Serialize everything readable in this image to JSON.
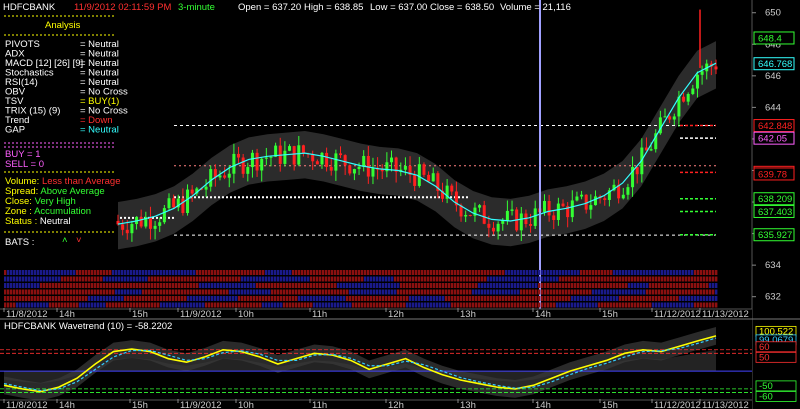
{
  "header": {
    "symbol": "HDFCBANK",
    "datetime": "11/9/2012 02:11:59 PM",
    "interval": "3-minute",
    "open": "Open = 637.20",
    "high": "High = 638.85",
    "low": "Low = 637.00",
    "close": "Close = 638.50",
    "volume": "Volume = 21,116"
  },
  "analysis": {
    "title": "Analysis",
    "rows": [
      {
        "label": "PIVOTS",
        "value": "= Neutral",
        "color": "#ffffff"
      },
      {
        "label": "ADX",
        "value": "= Neutral",
        "color": "#ffffff"
      },
      {
        "label": "MACD [12] [26] [9]",
        "value": "= Neutral",
        "color": "#ffffff"
      },
      {
        "label": "Stochastics",
        "value": "= Neutral",
        "color": "#ffffff"
      },
      {
        "label": "RSI(14)",
        "value": "= Neutral",
        "color": "#ffffff"
      },
      {
        "label": "OBV",
        "value": "= No Cross",
        "color": "#ffffff"
      },
      {
        "label": "TSV",
        "value": "= BUY(1)",
        "color": "#ffff00"
      },
      {
        "label": "TRIX (15) (9)",
        "value": "= No Cross",
        "color": "#ffffff"
      },
      {
        "label": "Trend",
        "value": "= Down",
        "color": "#ff3030"
      },
      {
        "label": "GAP",
        "value": "= Neutral",
        "color": "#33ffff"
      }
    ],
    "buy": "BUY  =   1",
    "sell": "SELL  =   0",
    "volume_rows": [
      {
        "label": "Volume:",
        "value": "Less than Average",
        "value_color": "#ff3030"
      },
      {
        "label": "Spread:",
        "value": "Above Average",
        "value_color": "#33ff33"
      },
      {
        "label": "Close:",
        "value": "Very High",
        "value_color": "#33ff33"
      },
      {
        "label": "Zone :",
        "value": "Accumulation",
        "value_color": "#33ff33"
      },
      {
        "label": "Status :",
        "value": "Neutral",
        "value_color": "#ffffff"
      }
    ],
    "bats_label": "BATS :"
  },
  "chart_data": [
    {
      "type": "candlestick",
      "title": "HDFCBANK",
      "y_range": [
        631.6,
        650.3
      ],
      "y_ticks": [
        632,
        634,
        636,
        638,
        640,
        642,
        644,
        646,
        648,
        650
      ],
      "x_tick_labels": [
        "11/8/2012",
        "14h",
        "15h",
        "11/9/2012",
        "10h",
        "11h",
        "12h",
        "13h",
        "14h",
        "15h",
        "11/12/2012",
        "11/13/2012"
      ],
      "price_labels": [
        {
          "value": "648.4",
          "color": "#33ff33"
        },
        {
          "value": "646.768",
          "color": "#33ffff"
        },
        {
          "value": "642.848",
          "color": "#ff2020"
        },
        {
          "value": "642.05",
          "color": "#ff60ff"
        },
        {
          "value": "639.884",
          "color": "#ff2020"
        },
        {
          "value": "639.78",
          "color": "#ff2020"
        },
        {
          "value": "638.209",
          "color": "#33ff33"
        },
        {
          "value": "637.403",
          "color": "#33ff33"
        },
        {
          "value": "635.927",
          "color": "#33ff33"
        }
      ],
      "levels": [
        {
          "value": 642.848,
          "color": "#ff2020"
        },
        {
          "value": 642.05,
          "color": "#ffffff"
        },
        {
          "value": 639.884,
          "color": "#ff2020"
        },
        {
          "value": 638.209,
          "color": "#33ff33"
        },
        {
          "value": 637.403,
          "color": "#33ff33"
        },
        {
          "value": 635.927,
          "color": "#33ff33"
        }
      ],
      "trend_line": [
        636.6,
        636.8,
        637.1,
        637.6,
        638.4,
        639.4,
        640.2,
        640.7,
        640.9,
        641.0,
        641.1,
        640.9,
        640.6,
        640.3,
        640.1,
        640.0,
        639.7,
        639.0,
        638.0,
        637.3,
        636.9,
        636.8,
        637.0,
        637.4,
        637.6,
        637.9,
        638.4,
        639.2,
        640.6,
        642.6,
        644.6,
        646.2,
        646.8
      ],
      "series_colors": {
        "up": "#33ff33",
        "down": "#ff2020",
        "trend": "#33ffff"
      }
    },
    {
      "type": "line",
      "title": "HDFCBANK  Wavetrend (10) = -58.2202",
      "y_range": [
        -70,
        110
      ],
      "y_tick_labels": [
        "100.522",
        "99.0679",
        "60",
        "50",
        "-50",
        "-60"
      ],
      "series": [
        {
          "values": [
            -40,
            -50,
            -58,
            -45,
            -20,
            20,
            55,
            62,
            55,
            35,
            25,
            40,
            60,
            55,
            40,
            20,
            35,
            50,
            45,
            30,
            5,
            20,
            35,
            10,
            -10,
            -25,
            -35,
            -45,
            -50,
            -40,
            -20,
            0,
            15,
            30,
            50,
            60,
            55,
            70,
            85,
            99
          ]
        },
        {
          "values": [
            -35,
            -45,
            -55,
            -50,
            -30,
            5,
            40,
            58,
            58,
            45,
            30,
            35,
            52,
            57,
            48,
            30,
            30,
            45,
            47,
            36,
            15,
            15,
            28,
            18,
            0,
            -18,
            -30,
            -40,
            -48,
            -45,
            -30,
            -10,
            8,
            22,
            40,
            55,
            57,
            64,
            78,
            93
          ]
        }
      ],
      "levels": [
        60,
        50,
        -50,
        -60
      ]
    }
  ]
}
